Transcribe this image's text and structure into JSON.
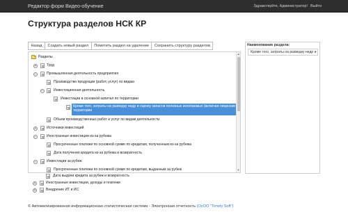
{
  "navbar": {
    "brand": "Редактор форм",
    "video": "Видео-обучение",
    "greeting": "Здравствуйте, Администратор!",
    "logout": "Выйти"
  },
  "page_title": "Структура разделов НСК КР",
  "toolbar": {
    "back": "Назад",
    "create": "Создать новый раздел",
    "mark_delete": "Пометить раздел на удаление",
    "save": "Сохранить структуру разделов"
  },
  "tree": {
    "root": "Разделы",
    "items": [
      "Труд",
      "Промышленная деятельность предприятия",
      "Производство продукции (работ, услуг) по видам",
      "Инвестиционная деятельность",
      "Инвестиции в основной капитал по территории",
      "Кроме того, затраты на разведку недр и оценку запасов полезных ископаемых (включая лицензии и бонусы) по территории",
      "Объем производственных работ и услуг по видам деятельности",
      "Источники инвестиций",
      "Иностранные инвестиции из-за рубежа",
      "Просроченные платежи по основной сумме по кредитам, полученным из-за рубежа",
      "Дата получения кредита из-за рубежа и возвратность",
      "Инвестиции за рубеж",
      "Просроченные платежи по основной сумме по кредитам, выданным за рубеж",
      "Дата выдачи кредита за рубеж и возвратность",
      "Иностранные инвестиции, доходы и платежи",
      "Внедрение ИТ и ИС"
    ]
  },
  "side_panel": {
    "label": "Наименование раздела:",
    "value": "Кроме того, затраты на разведку недр и оценку запасов"
  },
  "footer": {
    "text": "© Автоматизированная информационная статистическая система - Электронная отчетность",
    "link": "(ОсОО \"Timely Soft\")"
  },
  "colors": {
    "navbar": "#2e2e2e",
    "selection": "#4a90d9",
    "link": "#3a7bc8"
  }
}
